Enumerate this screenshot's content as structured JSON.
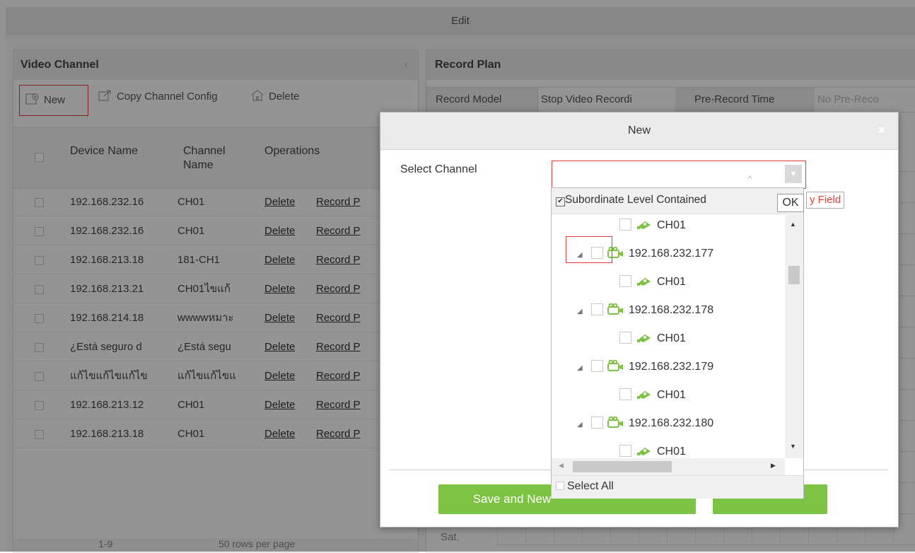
{
  "window": {
    "title": "Edit"
  },
  "video_channel": {
    "title": "Video Channel",
    "toolbar": {
      "new_label": "New",
      "copy_label": "Copy Channel Config",
      "delete_label": "Delete"
    },
    "columns": {
      "device_name": "Device Name",
      "channel_name_1": "Channel",
      "channel_name_2": "Name",
      "operations": "Operations"
    },
    "rows": [
      {
        "device": "192.168.232.16",
        "channel": "CH01",
        "op1": "Delete",
        "op2": "Record P"
      },
      {
        "device": "192.168.232.16",
        "channel": "CH01",
        "op1": "Delete",
        "op2": "Record P"
      },
      {
        "device": "192.168.213.18",
        "channel": "181-CH1",
        "op1": "Delete",
        "op2": "Record P"
      },
      {
        "device": "192.168.213.21",
        "channel": "CH01ไขแก้",
        "op1": "Delete",
        "op2": "Record P"
      },
      {
        "device": "192.168.214.18",
        "channel": "wwwwหมาะ",
        "op1": "Delete",
        "op2": "Record P"
      },
      {
        "device": "¿Está seguro d",
        "channel": "¿Está segu",
        "op1": "Delete",
        "op2": "Record P"
      },
      {
        "device": "แก้ไขแก้ไขแก้ไข",
        "channel": "แก้ไขแก้ไขแ",
        "op1": "Delete",
        "op2": "Record P"
      },
      {
        "device": "192.168.213.12",
        "channel": "CH01",
        "op1": "Delete",
        "op2": "Record P"
      },
      {
        "device": "192.168.213.18",
        "channel": "CH01",
        "op1": "Delete",
        "op2": "Record P"
      }
    ],
    "pager": {
      "range": "1-9",
      "rows_per_page": "50 rows per page"
    }
  },
  "record_plan": {
    "title": "Record Plan",
    "record_model_label": "Record Model",
    "record_model_value": "Stop Video Recordi",
    "pre_record_label": "Pre-Record Time",
    "pre_record_value": "No Pre-Reco",
    "day_label": "Sat."
  },
  "dialog": {
    "title": "New",
    "close_glyph": "×",
    "select_channel_label": "Select Channel",
    "required_hint": "y Field",
    "buttons": {
      "save_and_new": "Save and New",
      "ok": "",
      "cancel": ""
    }
  },
  "tree": {
    "subordinate_label": "Subordinate Level Contained",
    "subordinate_checked": true,
    "ok_label": "OK",
    "select_all_label": "Select All",
    "nodes": [
      {
        "type": "channel",
        "label": "CH01"
      },
      {
        "type": "device",
        "label": "192.168.232.177"
      },
      {
        "type": "channel",
        "label": "CH01"
      },
      {
        "type": "device",
        "label": "192.168.232.178"
      },
      {
        "type": "channel",
        "label": "CH01"
      },
      {
        "type": "device",
        "label": "192.168.232.179"
      },
      {
        "type": "channel",
        "label": "CH01"
      },
      {
        "type": "device",
        "label": "192.168.232.180"
      },
      {
        "type": "channel",
        "label": "CH01"
      }
    ]
  },
  "colors": {
    "accent_green": "#7cc243",
    "highlight_red": "#e53935"
  }
}
